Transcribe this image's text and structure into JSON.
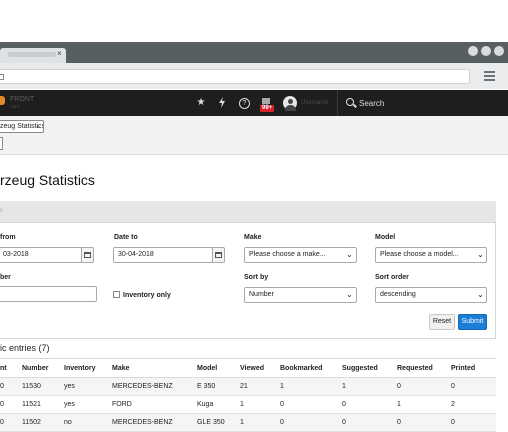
{
  "browser": {
    "tab_close": "×"
  },
  "app": {
    "brand_name": "FRONT",
    "brand_sub": "cars",
    "notification_count": "99+",
    "help_glyph": "?",
    "username": "Username",
    "search_label": "Search"
  },
  "toolbar": {
    "module_select_value": "zeug Statistics"
  },
  "page": {
    "title": "rzeug Statistics"
  },
  "filters": {
    "date_from_label": "from",
    "date_from_value": "03-2018",
    "date_to_label": "Date to",
    "date_to_value": "30-04-2018",
    "make_label": "Make",
    "make_placeholder": "Please choose a make...",
    "model_label": "Model",
    "model_placeholder": "Please choose a model...",
    "number_label": "ber",
    "number_value": "",
    "inventory_only_label": "Inventory only",
    "sort_by_label": "Sort by",
    "sort_by_value": "Number",
    "sort_order_label": "Sort order",
    "sort_order_value": "descending",
    "reset_label": "Reset",
    "submit_label": "Submit"
  },
  "results": {
    "title": "ic entries (7)",
    "headers": [
      "nt",
      "Number",
      "Inventory",
      "Make",
      "Model",
      "Viewed",
      "Bookmarked",
      "Suggested",
      "Requested",
      "Printed"
    ],
    "rows": [
      [
        "0",
        "11530",
        "yes",
        "MERCEDES-BENZ",
        "E 350",
        "21",
        "1",
        "1",
        "0",
        "0"
      ],
      [
        "0",
        "11521",
        "yes",
        "FORD",
        "Kuga",
        "1",
        "0",
        "0",
        "1",
        "2"
      ],
      [
        "0",
        "11502",
        "no",
        "MERCEDES-BENZ",
        "GLE 350",
        "1",
        "0",
        "0",
        "0",
        "0"
      ]
    ]
  },
  "colors": {
    "navbar_bg": "#1e1e1e",
    "primary_button": "#1a7dd6",
    "badge": "#d9232a",
    "brand_accent": "#e38b2b"
  },
  "icons": [
    "star-icon",
    "bolt-icon",
    "help-icon",
    "inbox-icon",
    "avatar-icon",
    "search-icon",
    "calendar-icon",
    "chevron-down-icon",
    "hamburger-menu-icon"
  ]
}
